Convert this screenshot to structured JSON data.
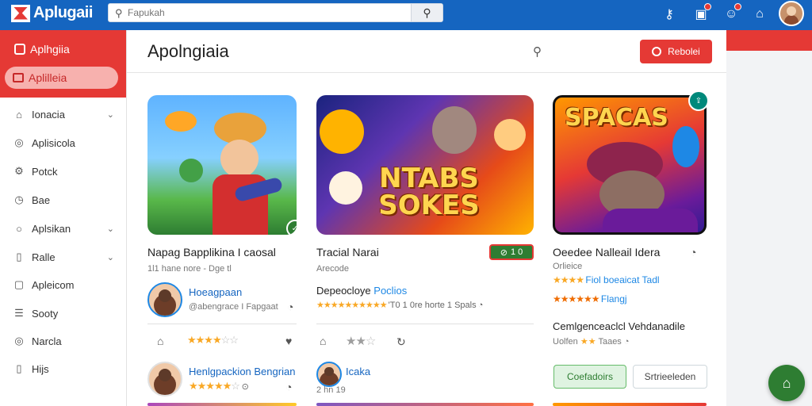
{
  "app": {
    "title": "Aplugaii"
  },
  "search": {
    "placeholder": "Fapukah"
  },
  "topbar": {
    "icons": [
      "key-icon",
      "notification-icon",
      "profile-icon",
      "home-icon"
    ]
  },
  "sidebar": {
    "header_title": "Aplhgiia",
    "active_label": "Aplilleia",
    "items": [
      {
        "label": "Ionacia",
        "icon": "tag-icon",
        "chevron": true
      },
      {
        "label": "Aplisicola",
        "icon": "compass-icon",
        "chevron": false
      },
      {
        "label": "Potck",
        "icon": "settings-icon",
        "chevron": false
      },
      {
        "label": "Bae",
        "icon": "clock-icon",
        "chevron": false
      },
      {
        "label": "Aplsikan",
        "icon": "circle-icon",
        "chevron": true
      },
      {
        "label": "Ralle",
        "icon": "document-icon",
        "chevron": true
      },
      {
        "label": "Apleicom",
        "icon": "app-icon",
        "chevron": false
      },
      {
        "label": "Sooty",
        "icon": "list-icon",
        "chevron": false
      },
      {
        "label": "Narcla",
        "icon": "globe-icon",
        "chevron": false
      },
      {
        "label": "Hijs",
        "icon": "phone-icon",
        "chevron": false
      }
    ]
  },
  "main": {
    "title": "Apolngiaia",
    "header_button": "Rebolei",
    "cards": [
      {
        "title": "Napag Bapplikina I caosal",
        "subtitle": "1l1 hane nore - Dge tl",
        "developer": "Hoeagpaan",
        "developer_sub": "@abengrace I Fapgaat",
        "rating": 3.5,
        "dev2": "Henlgpackion Bengrian",
        "rating2": 4.5
      },
      {
        "title": "Tracial Narai",
        "subtitle": "Arecode",
        "price": "1 0",
        "developer": "Depeocloye",
        "developer_tag": "Poclios",
        "rating_text": "'T0 1 0re horte 1 Spals",
        "rating": 2.5,
        "dev2": "Icaka",
        "dev2_sub": "2 hn 19"
      },
      {
        "title": "Oeedee Nalleail Idera",
        "subtitle": "Orlieice",
        "rating_line1": "Fiol boeaicat Tadl",
        "rating_line2": "Flangj",
        "section_title": "Cemlgenceaclcl Vehdanadile",
        "section_sub": "Uolfen",
        "section_stars": "Taaes",
        "button_primary": "Coefadoirs",
        "button_secondary": "Srtrieeleden"
      }
    ],
    "thumb_words": {
      "card2": "NTABS SOKES",
      "card3": "SPACAS"
    }
  },
  "colors": {
    "brand_blue": "#1565c0",
    "accent_red": "#e53935",
    "accent_green": "#2e7d32",
    "star": "#f9a825"
  }
}
